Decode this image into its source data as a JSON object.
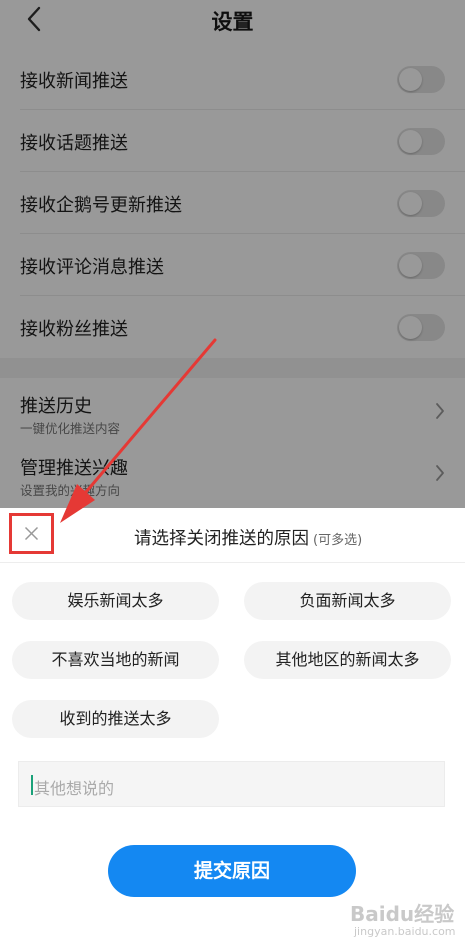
{
  "header": {
    "title": "设置",
    "back_icon": "chevron-left-icon"
  },
  "settings": {
    "toggles": [
      {
        "label": "接收新闻推送",
        "on": false
      },
      {
        "label": "接收话题推送",
        "on": false
      },
      {
        "label": "接收企鹅号更新推送",
        "on": false
      },
      {
        "label": "接收评论消息推送",
        "on": false
      },
      {
        "label": "接收粉丝推送",
        "on": false
      }
    ],
    "links": [
      {
        "title": "推送历史",
        "subtitle": "一键优化推送内容"
      },
      {
        "title": "管理推送兴趣",
        "subtitle": "设置我的兴趣方向"
      }
    ]
  },
  "sheet": {
    "title": "请选择关闭推送的原因",
    "subtitle": "(可多选)",
    "reasons": [
      "娱乐新闻太多",
      "负面新闻太多",
      "不喜欢当地的新闻",
      "其他地区的新闻太多",
      "收到的推送太多"
    ],
    "input_placeholder": "其他想说的",
    "submit_label": "提交原因"
  },
  "watermark": {
    "line1": "Baidu经验",
    "line2": "jingyan.baidu.com"
  },
  "colors": {
    "accent": "#1488f2",
    "highlight": "#e53935",
    "overlay": "rgba(0,0,0,0.4)"
  }
}
